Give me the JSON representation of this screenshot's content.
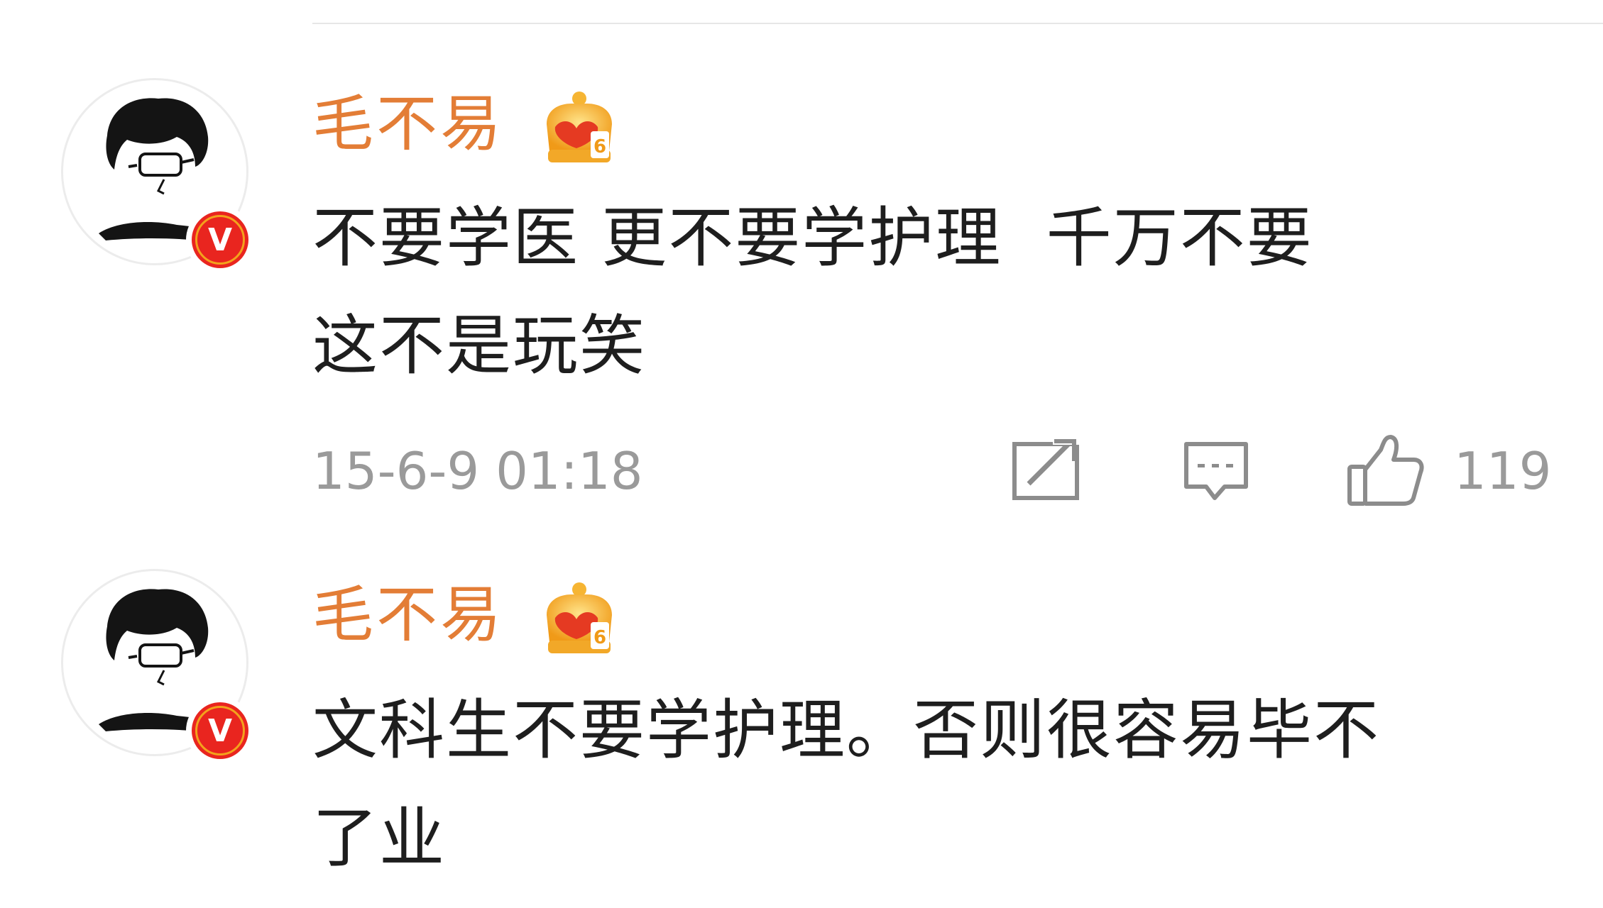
{
  "comments": [
    {
      "user": {
        "name": "毛不易",
        "avatar_icon": "avatar-cartoon-face",
        "verified_icon": "verified-v-badge",
        "vip_icon": "vip-crown-icon",
        "vip_level": "6",
        "verified_mark": "V"
      },
      "text": "不要学医 更不要学护理  千万不要\n这不是玩笑",
      "timestamp": "15-6-9 01:18",
      "actions": {
        "repost_icon": "repost-icon",
        "comment_icon": "comment-icon",
        "like_icon": "thumbs-up-icon",
        "like_count": "119"
      }
    },
    {
      "user": {
        "name": "毛不易",
        "avatar_icon": "avatar-cartoon-face",
        "verified_icon": "verified-v-badge",
        "vip_icon": "vip-crown-icon",
        "vip_level": "6",
        "verified_mark": "V"
      },
      "text": "文科生不要学护理。否则很容易毕不\n了业"
    }
  ],
  "colors": {
    "username": "#e37d36",
    "body_text": "#1e1e1e",
    "meta_text": "#9a9a9a",
    "verified_red": "#e9251f",
    "verified_ring": "#f3a21c",
    "crown_gold": "#f3a01f",
    "crown_red": "#e53a22"
  }
}
